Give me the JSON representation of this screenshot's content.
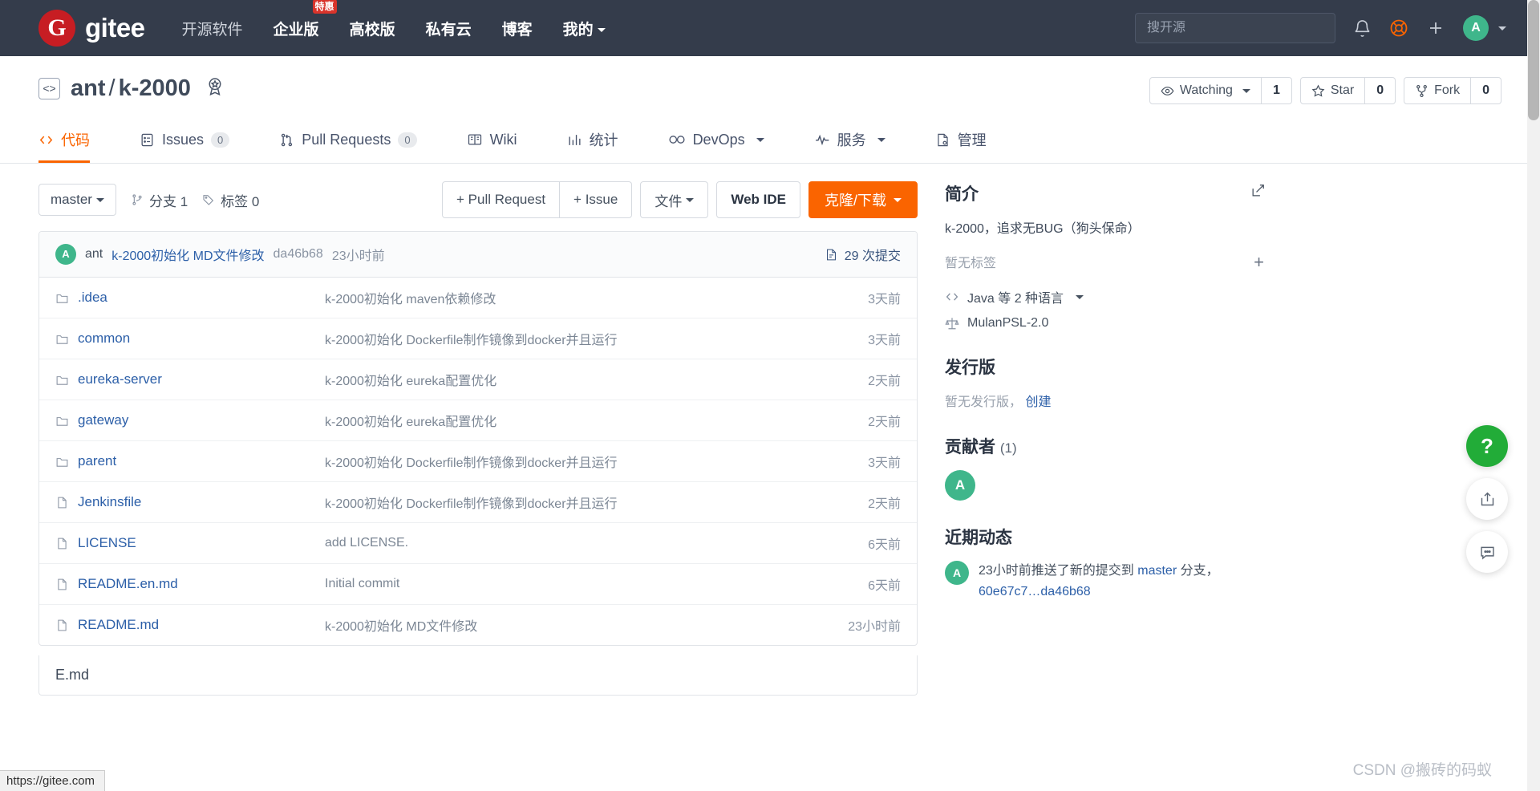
{
  "navbar": {
    "brand": "gitee",
    "logo_letter": "G",
    "links": [
      {
        "label": "开源软件",
        "badge": null,
        "caret": false
      },
      {
        "label": "企业版",
        "badge": "特惠",
        "caret": false
      },
      {
        "label": "高校版",
        "badge": null,
        "caret": false
      },
      {
        "label": "私有云",
        "badge": null,
        "caret": false
      },
      {
        "label": "博客",
        "badge": null,
        "caret": false
      },
      {
        "label": "我的",
        "badge": null,
        "caret": true
      }
    ],
    "search_placeholder": "搜开源",
    "icons": [
      "bell-icon",
      "lifebuoy-icon",
      "plus-icon"
    ],
    "avatar_letter": "A"
  },
  "repo": {
    "owner": "ant",
    "separator": "/",
    "name": "k-2000",
    "code_icon": "<>",
    "award_icon": "award-icon",
    "actions": [
      {
        "icon": "eye-icon",
        "label": "Watching",
        "caret": true,
        "count": "1"
      },
      {
        "icon": "star-icon",
        "label": "Star",
        "caret": false,
        "count": "0"
      },
      {
        "icon": "fork-icon",
        "label": "Fork",
        "caret": false,
        "count": "0"
      }
    ]
  },
  "tabs": [
    {
      "label": "代码",
      "icon": "code-icon",
      "count": null,
      "active": true,
      "caret": false
    },
    {
      "label": "Issues",
      "icon": "issue-icon",
      "count": "0",
      "active": false,
      "caret": false
    },
    {
      "label": "Pull Requests",
      "icon": "pr-icon",
      "count": "0",
      "active": false,
      "caret": false
    },
    {
      "label": "Wiki",
      "icon": "book-icon",
      "count": null,
      "active": false,
      "caret": false
    },
    {
      "label": "统计",
      "icon": "chart-icon",
      "count": null,
      "active": false,
      "caret": false
    },
    {
      "label": "DevOps",
      "icon": "infinity-icon",
      "count": null,
      "active": false,
      "caret": true
    },
    {
      "label": "服务",
      "icon": "pulse-icon",
      "count": null,
      "active": false,
      "caret": true
    },
    {
      "label": "管理",
      "icon": "settings-doc-icon",
      "count": null,
      "active": false,
      "caret": false
    }
  ],
  "toolbar": {
    "branch": "master",
    "branches_label": "分支 1",
    "tags_label": "标签 0",
    "pull_request": "+ Pull Request",
    "issue": "+ Issue",
    "files": "文件",
    "web_ide": "Web IDE",
    "clone": "克隆/下载"
  },
  "commit_bar": {
    "avatar_letter": "A",
    "author": "ant",
    "message": "k-2000初始化 MD文件修改",
    "sha": "da46b68",
    "time": "23小时前",
    "commits_label": "29 次提交"
  },
  "files": [
    {
      "type": "folder",
      "name": ".idea",
      "message": "k-2000初始化 maven依赖修改",
      "time": "3天前"
    },
    {
      "type": "folder",
      "name": "common",
      "message": "k-2000初始化 Dockerfile制作镜像到docker并且运行",
      "time": "3天前"
    },
    {
      "type": "folder",
      "name": "eureka-server",
      "message": "k-2000初始化 eureka配置优化",
      "time": "2天前"
    },
    {
      "type": "folder",
      "name": "gateway",
      "message": "k-2000初始化 eureka配置优化",
      "time": "2天前"
    },
    {
      "type": "folder",
      "name": "parent",
      "message": "k-2000初始化 Dockerfile制作镜像到docker并且运行",
      "time": "3天前"
    },
    {
      "type": "file",
      "name": "Jenkinsfile",
      "message": "k-2000初始化 Dockerfile制作镜像到docker并且运行",
      "time": "2天前"
    },
    {
      "type": "file",
      "name": "LICENSE",
      "message": "add LICENSE.",
      "time": "6天前"
    },
    {
      "type": "file",
      "name": "README.en.md",
      "message": "Initial commit",
      "time": "6天前"
    },
    {
      "type": "file",
      "name": "README.md",
      "message": "k-2000初始化 MD文件修改",
      "time": "23小时前"
    }
  ],
  "readme_partial": "E.md",
  "sidebar": {
    "intro_title": "简介",
    "intro_text": "k-2000，追求无BUG（狗头保命）",
    "no_tags": "暂无标签",
    "languages": "Java 等 2 种语言",
    "license": "MulanPSL-2.0",
    "releases_title": "发行版",
    "releases_empty": "暂无发行版，",
    "releases_create": "创建",
    "contributors_title": "贡献者",
    "contributors_count": "(1)",
    "contributor_avatar": "A",
    "activity_title": "近期动态",
    "activity_avatar": "A",
    "activity_text_1": "23小时前推送了新的提交到 ",
    "activity_branch": "master",
    "activity_text_2": " 分支，",
    "activity_sha": "60e67c7…da46b68"
  },
  "fabs": [
    {
      "icon": "question-icon",
      "style": "green"
    },
    {
      "icon": "share-icon",
      "style": "white"
    },
    {
      "icon": "comment-icon",
      "style": "white"
    }
  ],
  "statusbar": {
    "url": "https://gitee.com"
  },
  "watermark": "CSDN @搬砖的码蚁",
  "colors": {
    "accent": "#fa6400",
    "navbar": "#343c4b",
    "link": "#2c5fa8",
    "green": "#3fb68b",
    "red": "#c71d23"
  }
}
